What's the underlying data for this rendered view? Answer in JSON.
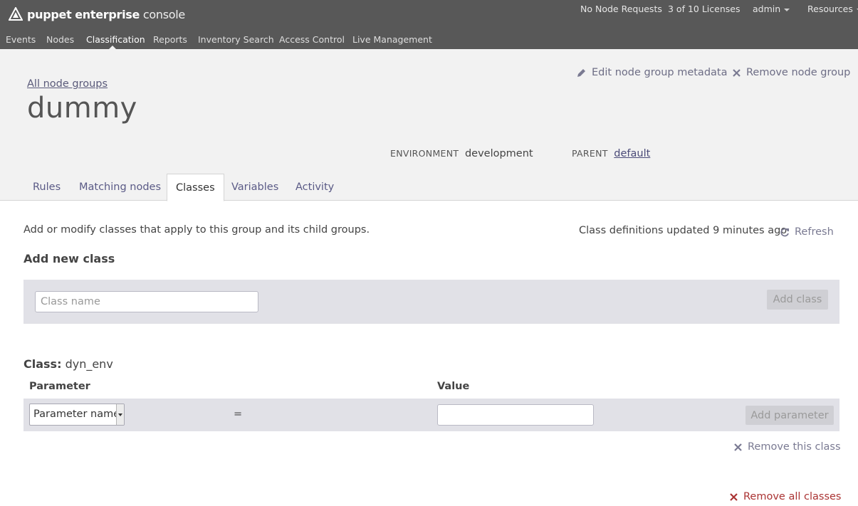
{
  "app": {
    "logo_bold": "puppet",
    "logo_mid": "enterprise",
    "logo_light": "console"
  },
  "utility": {
    "node_requests": "No Node Requests",
    "licenses": "3 of 10 Licenses",
    "user": "admin",
    "resources": "Resources"
  },
  "nav": {
    "items": [
      "Events",
      "Nodes",
      "Classification",
      "Reports",
      "Inventory Search",
      "Access Control",
      "Live Management"
    ],
    "active": "Classification"
  },
  "header": {
    "breadcrumb": "All node groups",
    "title": "dummy",
    "edit_metadata": "Edit node group metadata",
    "remove_group": "Remove node group",
    "environment_label": "ENVIRONMENT",
    "environment_value": "development",
    "parent_label": "PARENT",
    "parent_value": "default"
  },
  "tabs": [
    "Rules",
    "Matching nodes",
    "Classes",
    "Variables",
    "Activity"
  ],
  "active_tab": "Classes",
  "classes": {
    "intro": "Add or modify classes that apply to this group and its child groups.",
    "updated": "Class definitions updated 9 minutes ago",
    "refresh": "Refresh",
    "add_title": "Add new class",
    "class_placeholder": "Class name",
    "add_class_button": "Add class",
    "class_label": "Class:",
    "class_name": "dyn_env",
    "parameter_header": "Parameter",
    "value_header": "Value",
    "parameter_select": "Parameter name",
    "equals": "=",
    "add_parameter_button": "Add parameter",
    "remove_class": "Remove this class",
    "remove_all": "Remove all classes"
  },
  "colors": {
    "topbar": "#585858",
    "header_bg": "#f2f2f2",
    "panel_bg": "#e1e1e7",
    "link": "#5a5a86",
    "danger": "#aa3333"
  }
}
